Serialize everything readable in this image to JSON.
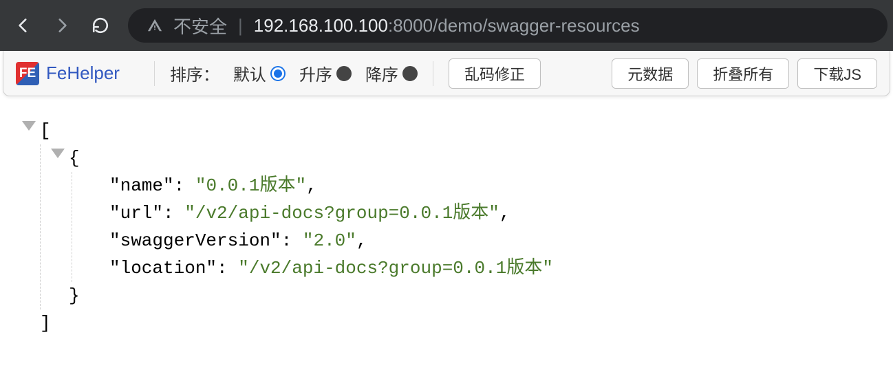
{
  "browser": {
    "insecure_label": "不安全",
    "url_host": "192.168.100.100",
    "url_port": ":8000",
    "url_path": "/demo/swagger-resources"
  },
  "toolbar": {
    "app_name": "FeHelper",
    "sort_label": "排序：",
    "sort_default": "默认",
    "sort_asc": "升序",
    "sort_desc": "降序",
    "btn_fix_encoding": "乱码修正",
    "btn_metadata": "元数据",
    "btn_collapse_all": "折叠所有",
    "btn_download": "下载JS"
  },
  "json": {
    "k_name": "\"name\"",
    "v_name": "\"0.0.1版本\"",
    "k_url": "\"url\"",
    "v_url": "\"/v2/api-docs?group=0.0.1版本\"",
    "k_swagger": "\"swaggerVersion\"",
    "v_swagger": "\"2.0\"",
    "k_location": "\"location\"",
    "v_location": "\"/v2/api-docs?group=0.0.1版本\""
  },
  "chart_data": [
    {
      "name": "0.0.1版本",
      "url": "/v2/api-docs?group=0.0.1版本",
      "swaggerVersion": "2.0",
      "location": "/v2/api-docs?group=0.0.1版本"
    }
  ]
}
